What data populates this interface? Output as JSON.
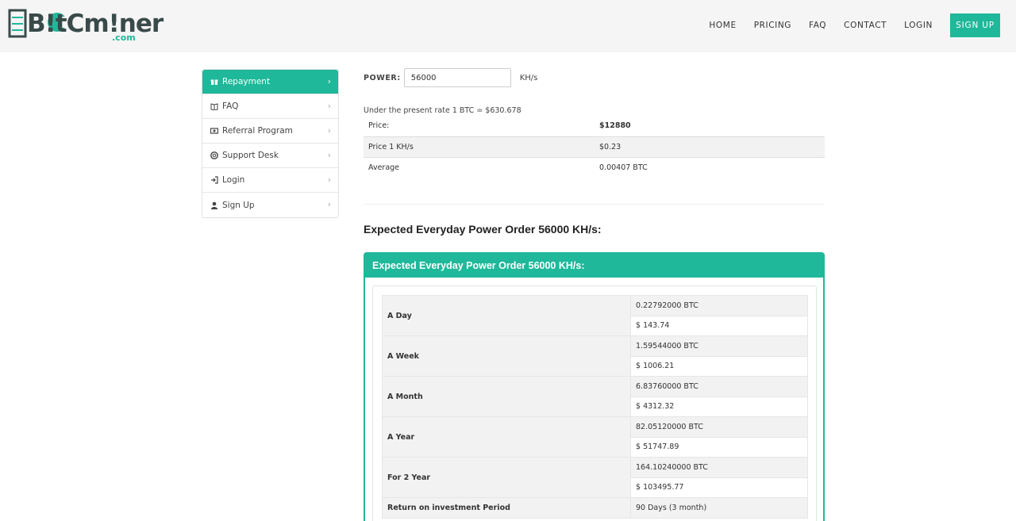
{
  "brand": {
    "logo_text": "B!tCm!ner",
    "logo_suffix": ".com",
    "accent_color": "#1fb89a"
  },
  "nav": {
    "items": [
      "HOME",
      "PRICING",
      "FAQ",
      "CONTACT",
      "LOGIN"
    ],
    "signup_label": "SIGN UP"
  },
  "sidebar": {
    "items": [
      {
        "label": "Repayment",
        "icon": "gift-icon",
        "active": true
      },
      {
        "label": "FAQ",
        "icon": "book-icon",
        "active": false
      },
      {
        "label": "Referral Program",
        "icon": "money-icon",
        "active": false
      },
      {
        "label": "Support Desk",
        "icon": "support-icon",
        "active": false
      },
      {
        "label": "Login",
        "icon": "login-icon",
        "active": false
      },
      {
        "label": "Sign Up",
        "icon": "user-icon",
        "active": false
      }
    ]
  },
  "calculator": {
    "power_label": "POWER:",
    "power_value": "56000",
    "power_unit": "KH/s",
    "rate_note": "Under the present rate 1 BTC = $630.678",
    "price_rows": [
      {
        "label": "Price:",
        "value": "$12880"
      },
      {
        "label": "Price 1 KH/s",
        "value": "$0.23"
      },
      {
        "label": "Average",
        "value": "0.00407 BTC"
      }
    ]
  },
  "expected": {
    "section_title": "Expected Everyday Power Order 56000 KH/s:",
    "panel_title": "Expected Everyday Power Order 56000 KH/s:",
    "rows": [
      {
        "label": "A Day",
        "btc": "0.22792000 BTC",
        "usd": "$ 143.74"
      },
      {
        "label": "A Week",
        "btc": "1.59544000 BTC",
        "usd": "$ 1006.21"
      },
      {
        "label": "A Month",
        "btc": "6.83760000 BTC",
        "usd": "$ 4312.32"
      },
      {
        "label": "A Year",
        "btc": "82.05120000 BTC",
        "usd": "$ 51747.89"
      },
      {
        "label": "For 2 Year",
        "btc": "164.10240000 BTC",
        "usd": "$ 103495.77"
      }
    ],
    "roi_label": "Return on investment Period",
    "roi_value": "90 Days (3 month)"
  }
}
